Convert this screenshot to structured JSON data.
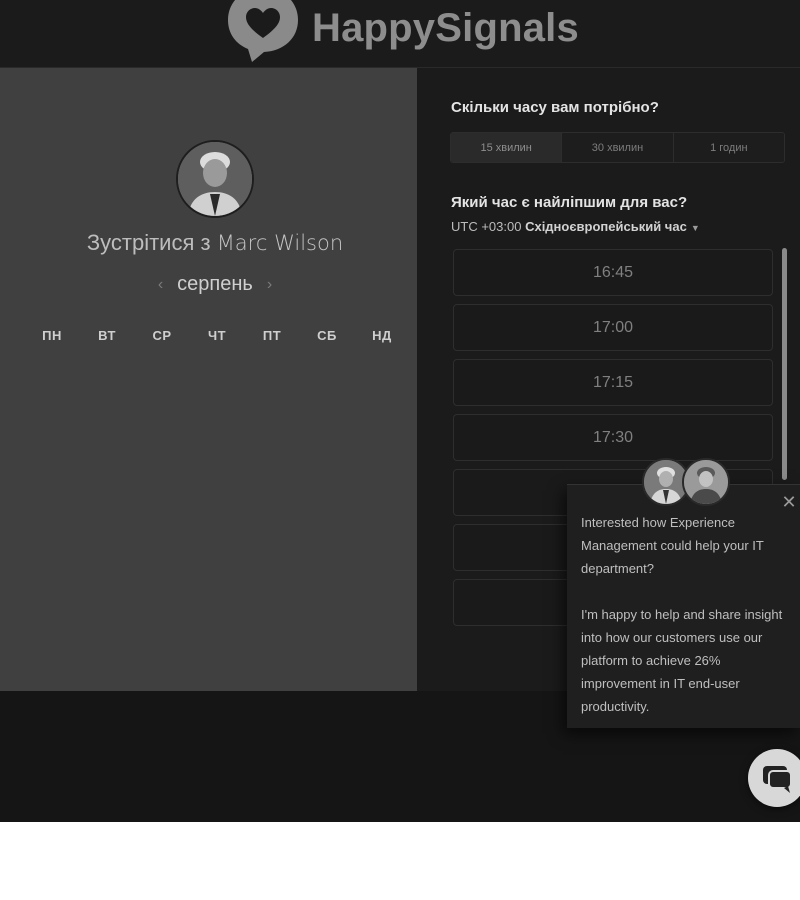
{
  "header": {
    "brand_name": "HappySignals",
    "logo_icon": "heart-speech-bubble-icon"
  },
  "left_panel": {
    "avatar_icon": "host-avatar",
    "meet_prefix": "Зустрітися з",
    "host_name": "Marc Wilson",
    "month": "серпень",
    "prev_icon": "chevron-left-icon",
    "next_icon": "chevron-right-icon",
    "weekdays": [
      "ПН",
      "ВТ",
      "СР",
      "ЧТ",
      "ПТ",
      "СБ",
      "НД"
    ]
  },
  "right_panel": {
    "duration_question": "Скільки часу вам потрібно?",
    "durations": [
      "15 хвилин",
      "30 хвилин",
      "1 годин"
    ],
    "selected_duration": "15 хвилин",
    "time_question": "Який час є найліпшим для вас?",
    "timezone_offset": "UTC +03:00",
    "timezone_name": "Східноєвропейський час",
    "slots": [
      "16:45",
      "17:00",
      "17:15",
      "17:30",
      "",
      "",
      ""
    ]
  },
  "chat_popup": {
    "paragraph_1": "Interested how Experience Management could help your IT department?",
    "paragraph_2": "I'm happy to help and share insight into how our customers use our platform to achieve 26% improvement in IT end-user productivity.",
    "close_icon": "close-icon",
    "chat_button_icon": "chat-bubble-icon"
  },
  "colors": {
    "page_bg": "#181818",
    "left_panel_bg": "#404040",
    "right_panel_bg": "#1b1b1b",
    "slot_border": "#2e2e2e"
  }
}
